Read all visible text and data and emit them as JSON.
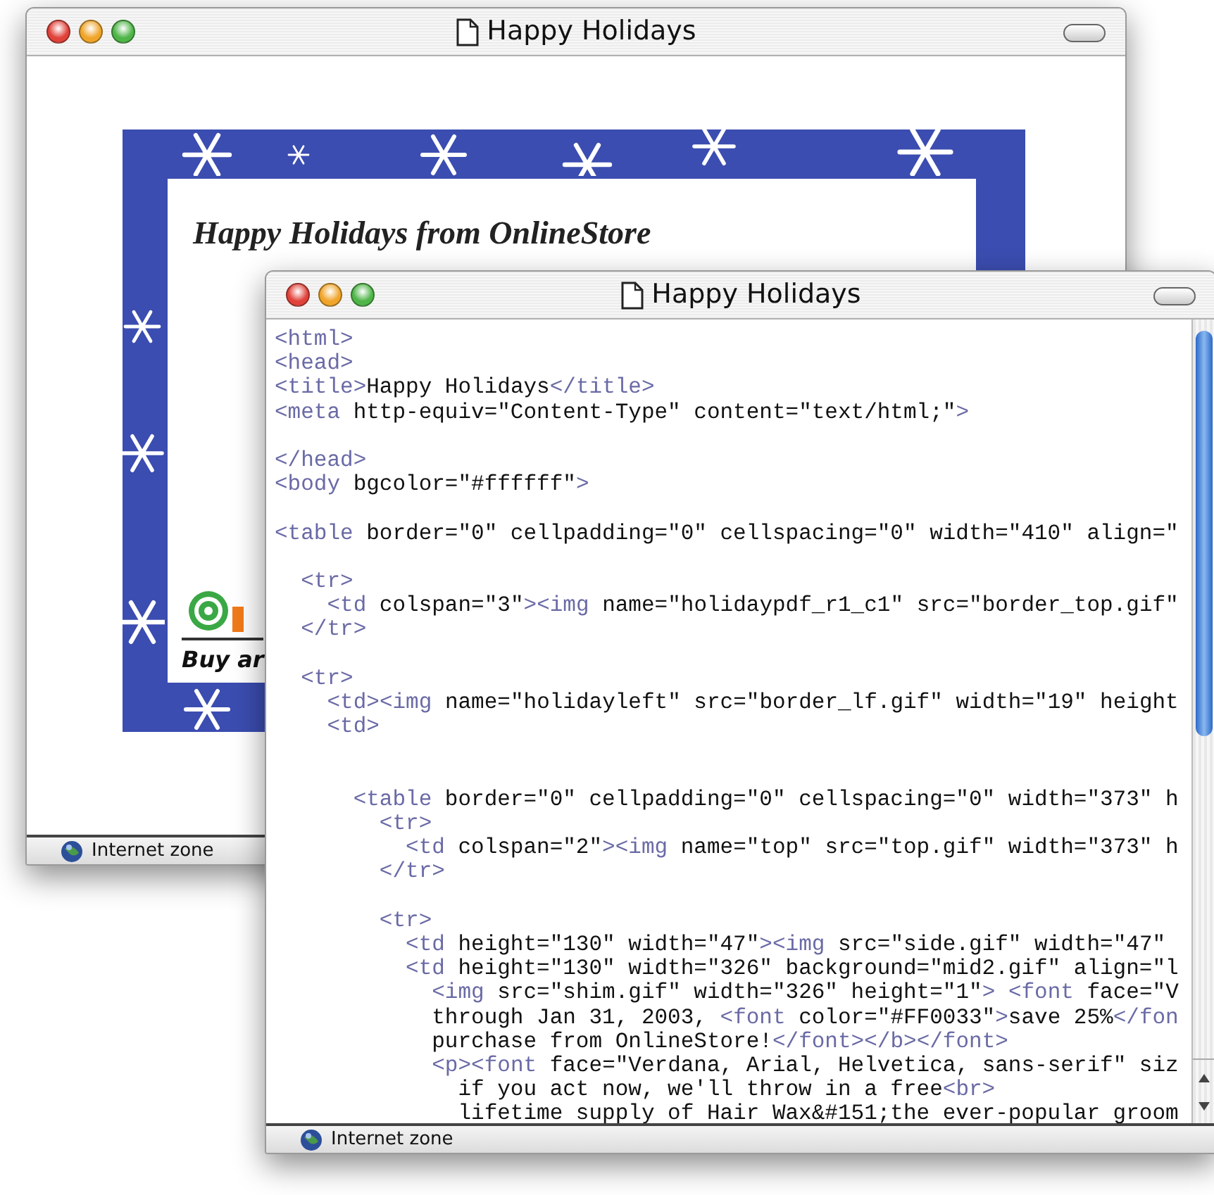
{
  "windows": [
    {
      "title": "Happy Holidays",
      "status": "Internet zone",
      "content": {
        "kind": "page",
        "heading": "Happy Holidays from OnlineStore",
        "tagline": "Buy ar"
      }
    },
    {
      "title": "Happy Holidays",
      "status": "Internet zone",
      "content": {
        "kind": "source",
        "blocks": [
          {
            "gap_before": false,
            "double_gap": false,
            "lines": [
              "<html>",
              "<head>",
              "<title>Happy Holidays</title>",
              "<meta http-equiv=\"Content-Type\" content=\"text/html;\">"
            ]
          },
          {
            "gap_before": true,
            "double_gap": false,
            "lines": [
              "</head>",
              "<body bgcolor=\"#ffffff\">"
            ]
          },
          {
            "gap_before": true,
            "double_gap": false,
            "lines": [
              "<table border=\"0\" cellpadding=\"0\" cellspacing=\"0\" width=\"410\" align=\""
            ]
          },
          {
            "gap_before": true,
            "double_gap": false,
            "lines": [
              "  <tr>",
              "    <td colspan=\"3\"><img name=\"holidaypdf_r1_c1\" src=\"border_top.gif\"",
              "  </tr>"
            ]
          },
          {
            "gap_before": true,
            "double_gap": false,
            "lines": [
              "  <tr>",
              "    <td><img name=\"holidayleft\" src=\"border_lf.gif\" width=\"19\" height",
              "    <td>"
            ]
          },
          {
            "gap_before": true,
            "double_gap": true,
            "lines": [
              "      <table border=\"0\" cellpadding=\"0\" cellspacing=\"0\" width=\"373\" h",
              "        <tr>",
              "          <td colspan=\"2\"><img name=\"top\" src=\"top.gif\" width=\"373\" h",
              "        </tr>"
            ]
          },
          {
            "gap_before": true,
            "double_gap": false,
            "lines": [
              "        <tr>",
              "          <td height=\"130\" width=\"47\"><img src=\"side.gif\" width=\"47\"",
              "          <td height=\"130\" width=\"326\" background=\"mid2.gif\" align=\"l",
              "            <img src=\"shim.gif\" width=\"326\" height=\"1\"> <font face=\"V",
              "            through Jan 31, 2003, <font color=\"#FF0033\">save 25%</fon",
              "            purchase from OnlineStore!</font></b></font>",
              "            <p><font face=\"Verdana, Arial, Helvetica, sans-serif\" siz",
              "              if you act now, we'll throw in a free<br>",
              "              lifetime supply of Hair Wax&#151;the ever-popular groom"
            ]
          }
        ]
      }
    }
  ]
}
